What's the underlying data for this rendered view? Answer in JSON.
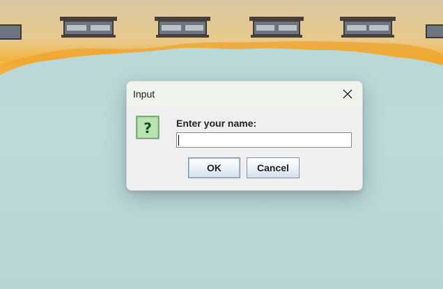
{
  "dialog": {
    "title": "Input",
    "prompt": "Enter your name:",
    "input_value": "",
    "ok_label": "OK",
    "cancel_label": "Cancel",
    "icon": "question-icon",
    "close_icon": "close-icon"
  },
  "colors": {
    "desktop_background": "#b9d8d9",
    "dialog_background": "#efefef",
    "titlebar_background": "#eef3ec",
    "icon_green": "#4f9a3c",
    "button_border": "#7f93a8"
  }
}
